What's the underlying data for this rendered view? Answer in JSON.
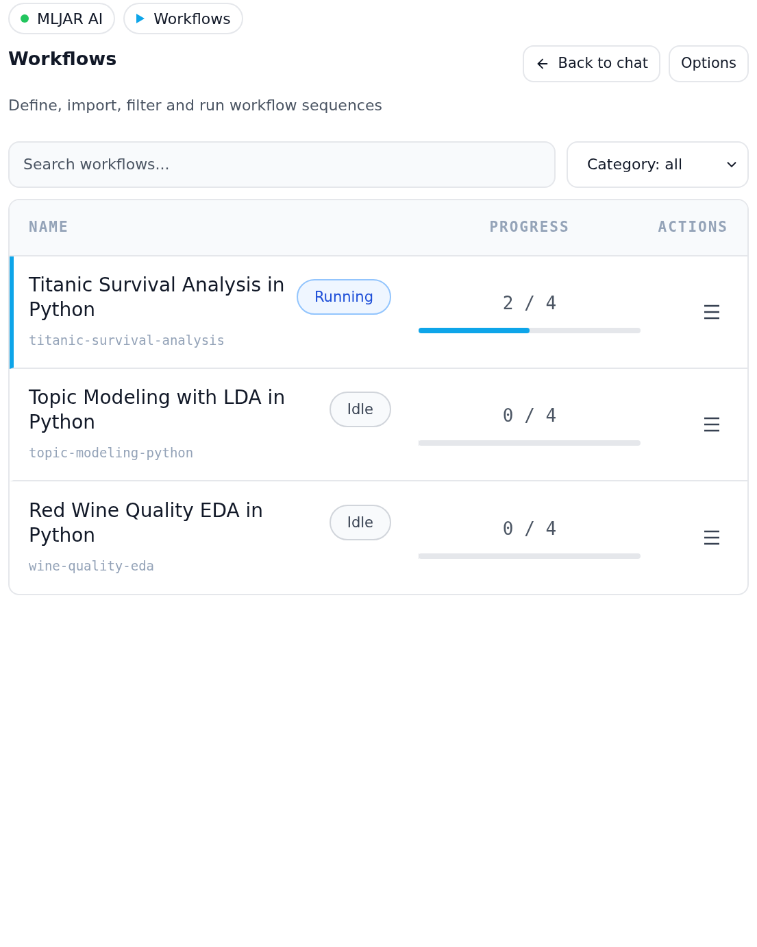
{
  "breadcrumbs": [
    {
      "label": "MLJAR AI",
      "kind": "status"
    },
    {
      "label": "Workflows",
      "kind": "play"
    }
  ],
  "header": {
    "title": "Workflows",
    "subtitle": "Define, import, filter and run workflow sequences",
    "buttons": [
      {
        "label": "Back to chat",
        "kind": "back"
      },
      {
        "label": "Options",
        "kind": "plain"
      }
    ]
  },
  "search": {
    "placeholder": "Search workflows..."
  },
  "category_select": {
    "value": "Category: all"
  },
  "table": {
    "columns": [
      "NAME",
      "PROGRESS",
      "ACTIONS"
    ],
    "rows": [
      {
        "name": "Titanic Survival Analysis in Python",
        "slug": "titanic-survival-analysis",
        "status": "Running",
        "running": true,
        "active": true,
        "progress": "2 / 4",
        "level": 0.5
      },
      {
        "name": "Topic Modeling with LDA in Python",
        "slug": "topic-modeling-python",
        "status": "Idle",
        "running": false,
        "active": false,
        "progress": "0 / 4",
        "level": 0
      },
      {
        "name": "Red Wine Quality EDA in Python",
        "slug": "wine-quality-eda",
        "status": "Idle",
        "running": false,
        "active": false,
        "progress": "0 / 4",
        "level": 0
      }
    ]
  }
}
